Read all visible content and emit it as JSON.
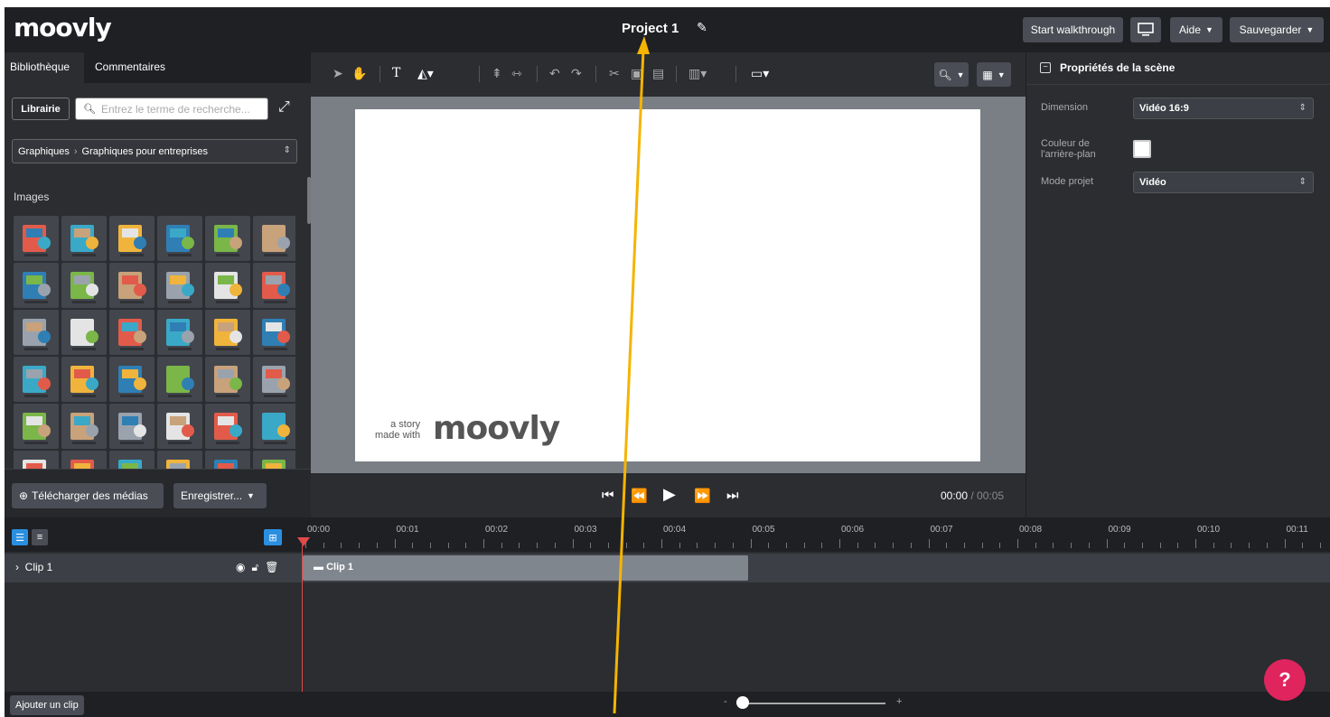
{
  "app": {
    "logo": "moovly",
    "project_title": "Project 1"
  },
  "topbar": {
    "walkthrough_label": "Start walkthrough",
    "help_label": "Aide",
    "save_label": "Sauvegarder"
  },
  "left": {
    "tabs": [
      "Bibliothèque",
      "Commentaires"
    ],
    "library_button": "Librairie",
    "search_placeholder": "Entrez le terme de recherche...",
    "category": {
      "parent": "Graphiques",
      "child": "Graphiques pour entreprises"
    },
    "images_heading": "Images",
    "upload_label": "Télécharger des médias",
    "record_label": "Enregistrer..."
  },
  "center": {
    "canvas_watermark_small": "a story\nmade with",
    "canvas_watermark_logo": "moovly",
    "time_current": "00:00",
    "time_separator": " / ",
    "time_total": "00:05"
  },
  "right": {
    "header": "Propriétés de la scène",
    "properties": [
      {
        "label": "Dimension",
        "value": "Vidéo 16:9"
      },
      {
        "label": "Couleur de l'arrière-plan",
        "value": ""
      },
      {
        "label": "Mode projet",
        "value": "Vidéo"
      }
    ],
    "background_color": "#ffffff"
  },
  "timeline": {
    "ruler": [
      "00:00",
      "00:01",
      "00:02",
      "00:03",
      "00:04",
      "00:05",
      "00:06",
      "00:07",
      "00:08",
      "00:09",
      "00:10",
      "00:11"
    ],
    "track_label": "Clip 1",
    "clip_label": "Clip 1",
    "add_clip_label": "Ajouter un clip"
  },
  "help_button": "?",
  "colors": {
    "accent_blue": "#2b8fe0",
    "playhead": "#e14a4a",
    "help": "#e0245e",
    "annotation": "#f5b400"
  }
}
